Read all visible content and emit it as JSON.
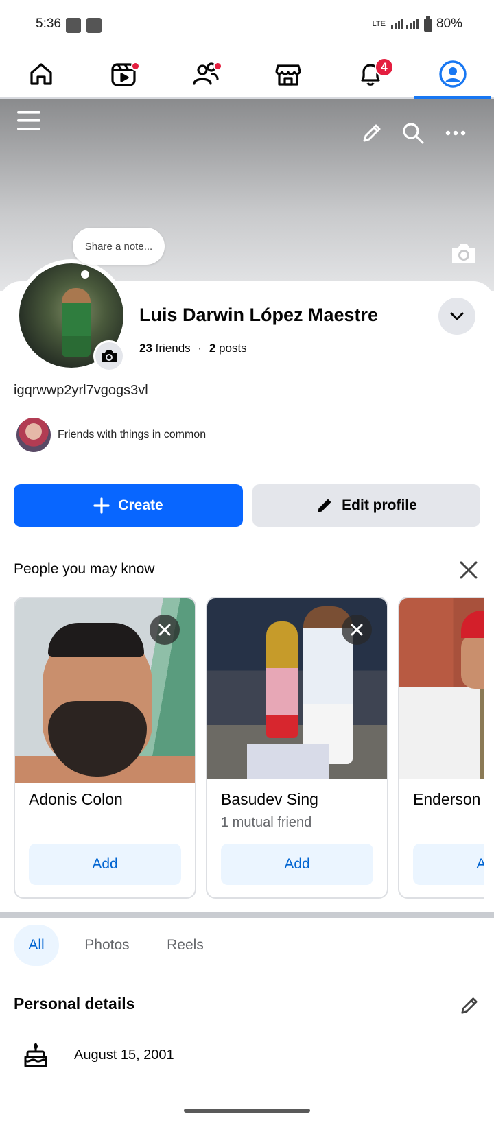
{
  "status_bar": {
    "time": "5:36",
    "network": "LTE",
    "battery": "80%"
  },
  "top_nav": {
    "items": [
      {
        "name": "home",
        "icon": "home-icon",
        "dot": false
      },
      {
        "name": "video",
        "icon": "video-icon",
        "dot": true
      },
      {
        "name": "friends",
        "icon": "friends-icon",
        "dot": true
      },
      {
        "name": "marketplace",
        "icon": "marketplace-icon",
        "dot": false
      },
      {
        "name": "notifications",
        "icon": "bell-icon",
        "badge": "4"
      },
      {
        "name": "profile",
        "icon": "profile-icon",
        "active": true
      }
    ],
    "notifications_badge": "4",
    "accent": "#1877f2",
    "alert_color": "#e41e3f"
  },
  "cover": {
    "note_placeholder": "Share a note...",
    "icons": [
      "menu-icon",
      "pencil-icon",
      "search-icon",
      "more-icon",
      "camera-icon"
    ]
  },
  "profile": {
    "name": "Luis Darwin López Maestre",
    "friends_count": "23",
    "friends_label": "friends",
    "posts_count": "2",
    "posts_label": "posts",
    "username": "igqrwwp2yrl7vgogs3vl",
    "common_text": "Friends with things in common"
  },
  "actions": {
    "create_label": "Create",
    "edit_label": "Edit profile",
    "primary_color": "#0866ff"
  },
  "pymk": {
    "title": "People you may know",
    "cards": [
      {
        "name": "Adonis Colon",
        "mutual": "",
        "add_label": "Add"
      },
      {
        "name": "Basudev Sing",
        "mutual": "1 mutual friend",
        "add_label": "Add"
      },
      {
        "name": "Enderson",
        "mutual": "",
        "add_label": "Add"
      }
    ]
  },
  "tabs": {
    "items": [
      "All",
      "Photos",
      "Reels"
    ],
    "active": "All"
  },
  "personal_details": {
    "title": "Personal details",
    "birthday": "August 15, 2001"
  }
}
